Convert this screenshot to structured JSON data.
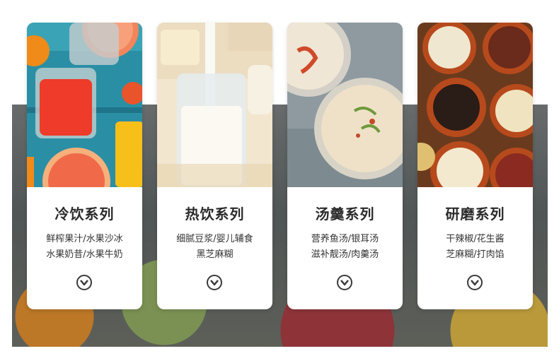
{
  "cards": [
    {
      "title": "冷饮系列",
      "line1": "鲜榨果汁/水果沙冰",
      "line2": "水果奶昔/水果牛奶",
      "photo": "cold-drinks-photo"
    },
    {
      "title": "热饮系列",
      "line1": "细腻豆浆/婴儿辅食",
      "line2": "黑芝麻糊",
      "photo": "milk-photo"
    },
    {
      "title": "汤羹系列",
      "line1": "营养鱼汤/银耳汤",
      "line2": "滋补靓汤/肉羹汤",
      "photo": "soup-photo"
    },
    {
      "title": "研磨系列",
      "line1": "干辣椒/花生酱",
      "line2": "芝麻糊/打肉馅",
      "photo": "grains-photo"
    }
  ],
  "icons": {
    "expand": "chevron-down-circle-icon"
  },
  "colors": {
    "title": "#2b2b2b",
    "text": "#333333",
    "card": "#ffffff"
  }
}
